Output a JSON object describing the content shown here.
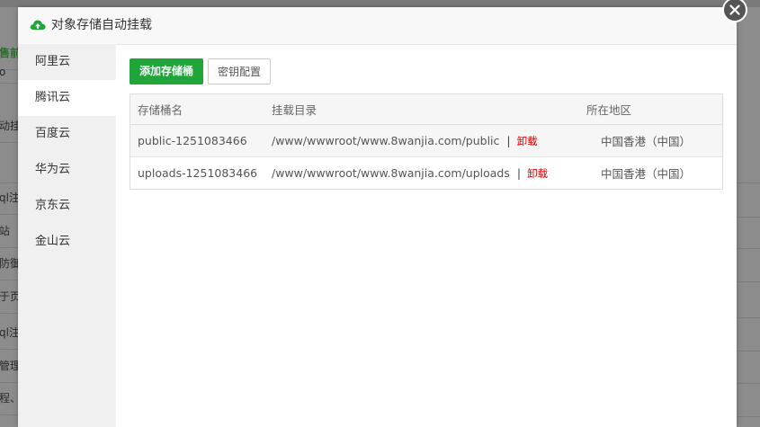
{
  "background": {
    "items": [
      "售前",
      "o",
      "动挂",
      "",
      "ql注",
      "站",
      "防御",
      "于页",
      "ql注",
      "管理",
      "程、"
    ]
  },
  "modal": {
    "title": "对象存储自动挂载",
    "sidebar": {
      "items": [
        {
          "label": "阿里云"
        },
        {
          "label": "腾讯云"
        },
        {
          "label": "百度云"
        },
        {
          "label": "华为云"
        },
        {
          "label": "京东云"
        },
        {
          "label": "金山云"
        }
      ],
      "active": 1
    },
    "toolbar": {
      "add_label": "添加存储桶",
      "key_label": "密钥配置"
    },
    "table": {
      "headers": [
        "存储桶名",
        "挂载目录",
        "所在地区"
      ],
      "rows": [
        {
          "bucket": "public-1251083466",
          "dir": "/www/wwwroot/www.8wanjia.com/public",
          "sep": "|",
          "action": "卸载",
          "region": "中国香港（中国）"
        },
        {
          "bucket": "uploads-1251083466",
          "dir": "/www/wwwroot/www.8wanjia.com/uploads",
          "sep": "|",
          "action": "卸载",
          "region": "中国香港（中国）"
        }
      ]
    }
  },
  "colors": {
    "primary": "#20a53a",
    "danger": "#dd0000"
  }
}
